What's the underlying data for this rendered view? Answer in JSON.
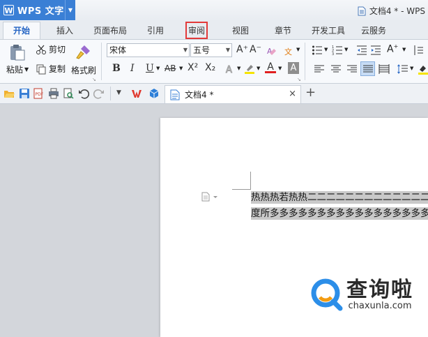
{
  "app": {
    "name": "WPS 文字",
    "logo": "W",
    "accent": "#3a7fd5"
  },
  "window": {
    "doc_title": "文档4 * - WPS"
  },
  "tabs": [
    {
      "label": "开始",
      "active": true
    },
    {
      "label": "插入"
    },
    {
      "label": "页面布局"
    },
    {
      "label": "引用"
    },
    {
      "label": "审阅",
      "highlighted": true
    },
    {
      "label": "视图"
    },
    {
      "label": "章节"
    },
    {
      "label": "开发工具"
    },
    {
      "label": "云服务"
    }
  ],
  "ribbon": {
    "paste": "粘贴",
    "cut": "剪切",
    "copy": "复制",
    "format_painter": "格式刷",
    "font_name": "宋体",
    "font_size": "五号",
    "bold": "B",
    "italic": "I",
    "underline": "U",
    "strikethrough": "AB",
    "superscript": "X²",
    "subscript": "X₂",
    "grow_font": "A⁺",
    "shrink_font": "A⁻",
    "font_color_letter": "A",
    "char_shade_letter": "A",
    "highlight_color": "#f5e400",
    "font_color": "#e02020"
  },
  "quickbar": {
    "icons": [
      "open-icon",
      "save-icon",
      "export-pdf-icon",
      "print-icon",
      "print-preview-icon",
      "undo-icon",
      "redo-icon",
      "customize-icon",
      "wps-logo-icon",
      "cloud-icon"
    ]
  },
  "document_tab": {
    "label": "文档4 *",
    "close": "×",
    "add": "+"
  },
  "document": {
    "lines": [
      "热热热若热热二二二二二二二二二二二二二二二二二",
      "度所多多多多多多多多多多多多多多多多多多多多多"
    ]
  },
  "watermark": {
    "brand": "查询啦",
    "url": "chaxunla.com"
  }
}
